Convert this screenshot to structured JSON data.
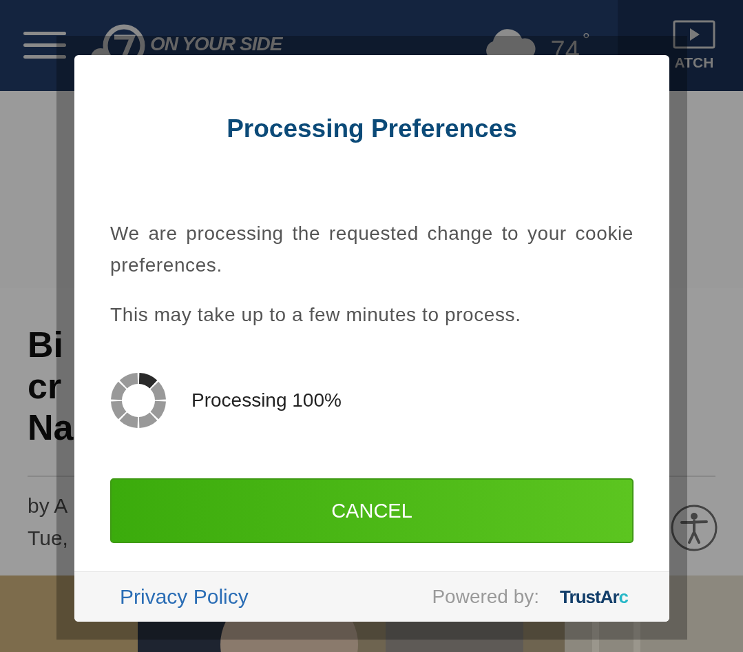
{
  "header": {
    "logo_text": "ON YOUR SIDE",
    "temperature": "74",
    "degree": "°",
    "watch_label": "ATCH"
  },
  "article": {
    "headline_lines": [
      "Bi",
      "cr",
      "Na"
    ],
    "byline_lines": [
      "by A",
      "Tue,"
    ]
  },
  "dialog": {
    "title": "Processing Preferences",
    "paragraphs": [
      "We are processing the requested change to your cookie preferences.",
      "This may take up to a few minutes to process."
    ],
    "progress": {
      "label": "Processing 100%"
    },
    "buttons": [
      {
        "label": "CANCEL"
      }
    ],
    "footer": {
      "link": "Privacy Policy",
      "powered_by": "Powered by:",
      "brand": "TrustArc"
    }
  }
}
